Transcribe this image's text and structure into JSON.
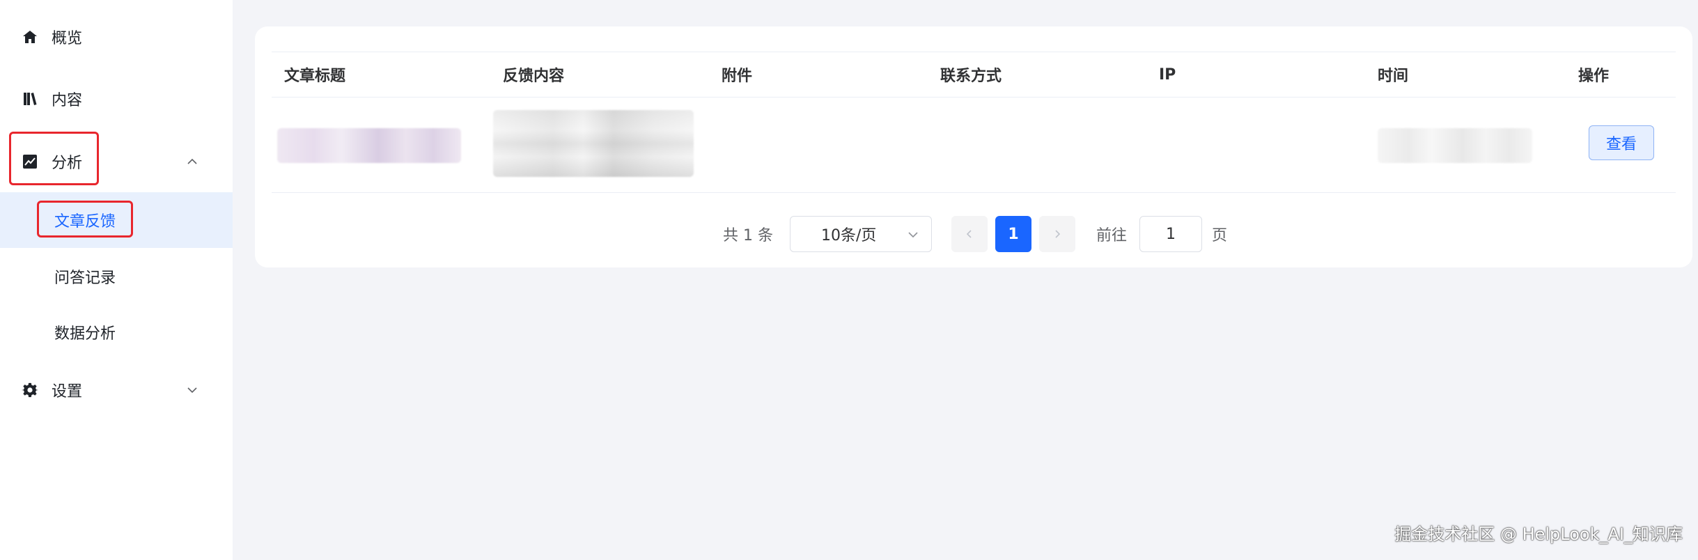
{
  "sidebar": {
    "items": [
      {
        "label": "概览",
        "icon": "home-icon"
      },
      {
        "label": "内容",
        "icon": "book-icon"
      },
      {
        "label": "分析",
        "icon": "chart-icon",
        "expanded": true
      },
      {
        "label": "设置",
        "icon": "gear-icon",
        "expanded": false
      }
    ],
    "submenu": [
      {
        "label": "文章反馈",
        "active": true
      },
      {
        "label": "问答记录",
        "active": false
      },
      {
        "label": "数据分析",
        "active": false
      }
    ]
  },
  "table": {
    "columns": [
      "文章标题",
      "反馈内容",
      "附件",
      "联系方式",
      "IP",
      "时间",
      "操作"
    ],
    "rows": [
      {
        "action_label": "查看"
      }
    ]
  },
  "pagination": {
    "total_text": "共 1 条",
    "page_size": "10条/页",
    "current_page": "1",
    "goto_label": "前往",
    "goto_value": "1",
    "goto_suffix": "页"
  },
  "watermark": "掘金技术社区 @ HelpLook_AI_知识库",
  "colors": {
    "accent": "#1a66ff",
    "active_bg": "#e8f0fd",
    "highlight_box": "#e8262d",
    "page_bg": "#f3f4f8"
  }
}
